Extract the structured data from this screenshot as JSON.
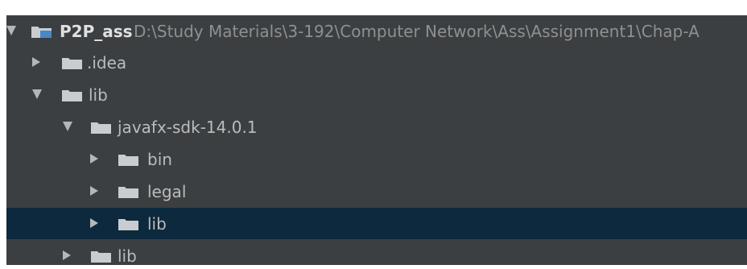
{
  "project_tree": {
    "root": {
      "name": "P2P_ass",
      "path": "D:\\Study Materials\\3-192\\Computer Network\\Ass\\Assignment1\\Chap-A",
      "expanded": true,
      "icon": "module-folder-icon"
    },
    "items": [
      {
        "label": ".idea",
        "expanded": false,
        "icon": "folder-icon"
      },
      {
        "label": "lib",
        "expanded": true,
        "icon": "folder-icon"
      },
      {
        "label": "javafx-sdk-14.0.1",
        "expanded": true,
        "icon": "folder-icon"
      },
      {
        "label": "bin",
        "expanded": false,
        "icon": "folder-icon"
      },
      {
        "label": "legal",
        "expanded": false,
        "icon": "folder-icon"
      },
      {
        "label": "lib",
        "expanded": false,
        "selected": true,
        "icon": "folder-icon"
      },
      {
        "label": "lib",
        "expanded": false,
        "icon": "folder-icon"
      }
    ]
  },
  "colors": {
    "panel_background": "#3c3f41",
    "selection": "#0d293e",
    "text": "#bbbbbb",
    "path_text": "#8f8f8f",
    "folder": "#c9cdd1",
    "arrow": "#b4b7b9"
  }
}
